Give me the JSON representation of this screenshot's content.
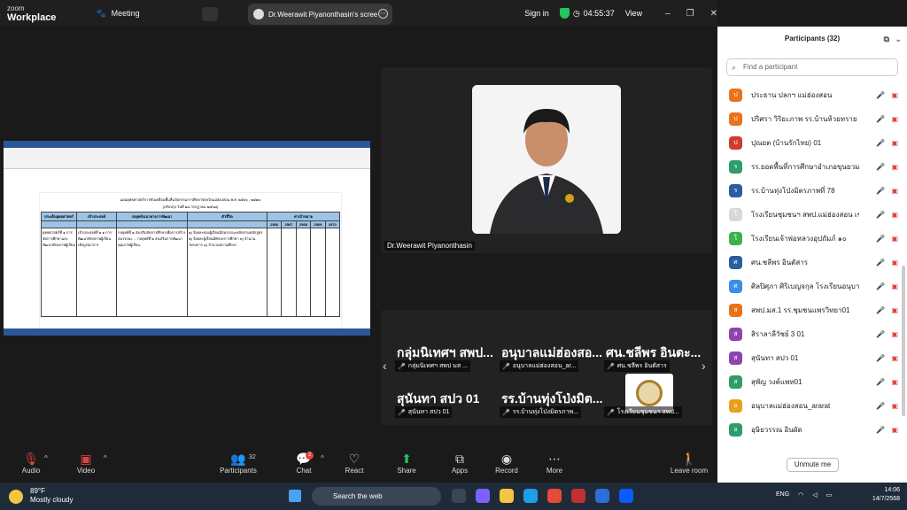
{
  "app": {
    "logo_line1": "zoom",
    "logo_line2": "Workplace",
    "meeting_label": "Meeting",
    "share_tab": "Dr.Weerawit Piyanonthasin's scree",
    "signin": "Sign in",
    "timer": "04:55:37",
    "view": "View"
  },
  "document": {
    "title": "แผนยุทธศาสตร์การขับเคลื่อนพื้นที่นวัตกรรมการศึกษาจังหวัดแม่ฮ่องสอน พ.ศ. ๒๕๖๖ - ๒๕๗๐",
    "subtitle": "(ปรับปรุง วันที่ ๑๔ กรกฎาคม ๒๕๖๘)",
    "headers": [
      "ประเด็นยุทธศาสตร์",
      "เป้าประสงค์",
      "กลยุทธ์/แนวทางการพัฒนา",
      "ตัวชี้วัด",
      "ค่าเป้าหมาย"
    ],
    "years": [
      "2566",
      "2567",
      "2568",
      "2569",
      "2570"
    ],
    "col1": "ยุทธศาสตร์ที่ ๑ การจัดการศึกษาและพัฒนาศักยภาพผู้เรียน",
    "col2": "เป้าประสงค์ที่ ๑.๑ การพัฒนาศักยภาพผู้เรียนเชิงบูรณาการ",
    "col3": "กลยุทธ์ที่ ๑ ส่งเสริมจัดการศึกษาเพื่อการสร้างสมรรถนะ ... กลยุทธ์ที่ ๒ ส่งเสริมการพัฒนาคุณภาพผู้เรียน",
    "col4": "๑) ร้อยละของผู้เรียนมีสมรรถนะหลักตามหลักสูตร ๒) ร้อยละผู้เรียนมีทักษะการศึกษา ๓) จำนวนโครงการ ๔) จำนวนสถานศึกษา"
  },
  "host": {
    "name": "Dr.Weerawit Piyanonthasin"
  },
  "gallery": [
    {
      "big": "กลุ่มนิเทศฯ สพป...",
      "label": "กลุ่มนิเทศฯ สพป มส ..."
    },
    {
      "big": "อนุบาลแม่ฮ่องสอ...",
      "label": "อนุบาลแม่ฮ่องสอน_ar..."
    },
    {
      "big": "ศน.ชลีพร อินตะ...",
      "label": "ศน.ชลีพร อินตัสาร"
    },
    {
      "big": "สุนันทา สปว 01",
      "label": "สุนันทา สปว 01"
    },
    {
      "big": "รร.บ้านทุ่งโป่งมิต...",
      "label": "รร.บ้านทุ่งโป่งมิตรภาพ..."
    },
    {
      "big": "",
      "label": "โรงเรียนชุมชนฯ สพป..."
    }
  ],
  "toolbar": {
    "audio": "Audio",
    "video": "Video",
    "participants": "Participants",
    "participants_count": "32",
    "chat": "Chat",
    "chat_badge": "2",
    "react": "React",
    "share": "Share",
    "apps": "Apps",
    "record": "Record",
    "more": "More",
    "leave": "Leave room"
  },
  "panel": {
    "title": "Participants (32)",
    "search_placeholder": "Find a participant",
    "unmute": "Unmute me",
    "participants": [
      {
        "initial": "ป",
        "name": "ประธาน ปลกฯ แม่ฮ่องสอน",
        "color": "#e8731a"
      },
      {
        "initial": "ป",
        "name": "ปริศรา วิริยะภาพ รร.บ้านห้วยทราย ส...",
        "color": "#e8731a"
      },
      {
        "initial": "ป",
        "name": "ปุณยต (บ้านรักไทย) 01",
        "color": "#d13b2e"
      },
      {
        "initial": "ร",
        "name": "รร.ยอดพื้นที่การศึกษาอำเภอขุนยวม 01",
        "color": "#2f9c6b"
      },
      {
        "initial": "ร",
        "name": "รร.บ้านทุ่งโป่งมิตรภาพที่ 78",
        "color": "#2a5f9e"
      },
      {
        "initial": "โ",
        "name": "โรงเรียนชุมชนฯ สพป.แม่ฮ่องสอน เขต ...",
        "color": "#d8d8d8"
      },
      {
        "initial": "โ",
        "name": "โรงเรียนเจ้าพ่อหลวงอุปถัมภ์ ๑๐",
        "color": "#3bb34a"
      },
      {
        "initial": "ศ",
        "name": "ศน.ชลีพร อินตัสาร",
        "color": "#2a5f9e"
      },
      {
        "initial": "ศ",
        "name": "ศิลปิศุภา ศิริเบญจกุล โรงเรียนอนุบาล...",
        "color": "#3a8ee6"
      },
      {
        "initial": "ส",
        "name": "สพป.มส.1 รร.ชุมชนแพรวิทยา01",
        "color": "#e8731a"
      },
      {
        "initial": "ส",
        "name": "สิราลาลีวัชย์ 3 01",
        "color": "#8e44ad"
      },
      {
        "initial": "ส",
        "name": "สุนันทา สปว 01",
        "color": "#8e44ad"
      },
      {
        "initial": "ส",
        "name": "สุพัญ วงค์แพท01",
        "color": "#2f9c6b"
      },
      {
        "initial": "อ",
        "name": "อนุบาลแม่ฮ่องสอน_ararat",
        "color": "#e8a01a"
      },
      {
        "initial": "อ",
        "name": "อุษิยวรรณ อินผัด",
        "color": "#2f9c6b"
      }
    ]
  },
  "taskbar": {
    "temp": "89°F",
    "weather": "Mostly cloudy",
    "search": "Search the web",
    "lang": "ENG",
    "time": "14:06",
    "date": "14/7/2568"
  }
}
